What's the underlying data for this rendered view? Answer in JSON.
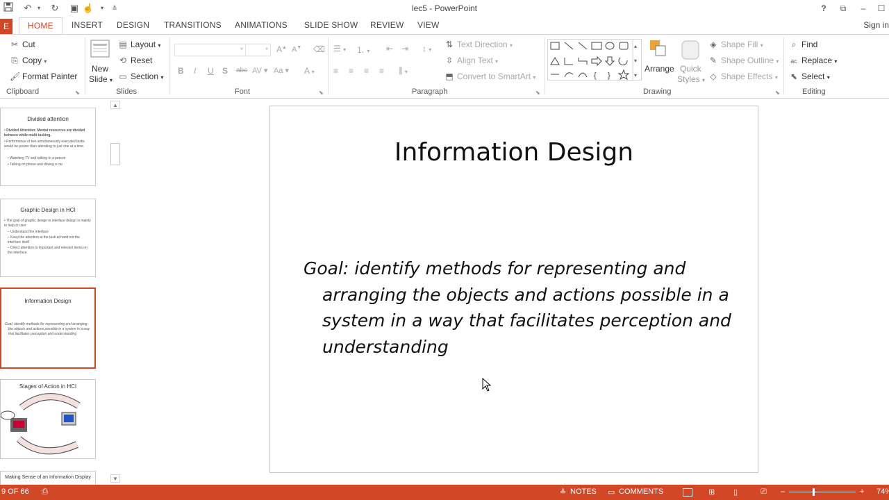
{
  "window": {
    "title": "lec5 - PowerPoint"
  },
  "qat": {
    "save_icon": "save-icon",
    "undo_icon": "undo-icon",
    "redo_icon": "redo-icon"
  },
  "tabs": {
    "file": "E",
    "home": "HOME",
    "insert": "INSERT",
    "design": "DESIGN",
    "transitions": "TRANSITIONS",
    "animations": "ANIMATIONS",
    "slideshow": "SLIDE SHOW",
    "review": "REVIEW",
    "view": "VIEW",
    "signin": "Sign in"
  },
  "ribbon": {
    "clipboard": {
      "cut": "Cut",
      "copy": "Copy",
      "format_painter": "Format Painter",
      "label": "Clipboard"
    },
    "slides": {
      "new_slide": "New",
      "new_slide2": "Slide",
      "layout": "Layout",
      "reset": "Reset",
      "section": "Section",
      "label": "Slides"
    },
    "font": {
      "label": "Font"
    },
    "paragraph": {
      "text_direction": "Text Direction",
      "align_text": "Align Text",
      "convert_smartart": "Convert to SmartArt",
      "label": "Paragraph"
    },
    "drawing": {
      "arrange": "Arrange",
      "quick_styles": "Quick",
      "quick_styles2": "Styles",
      "shape_fill": "Shape Fill",
      "shape_outline": "Shape Outline",
      "shape_effects": "Shape Effects",
      "label": "Drawing"
    },
    "editing": {
      "find": "Find",
      "replace": "Replace",
      "select": "Select",
      "label": "Editing"
    }
  },
  "thumbnails": [
    {
      "title": "Divided attention",
      "lines": [
        "Divided Attention: Mental resources are divided between while multi-tasking.",
        "Performance of two simultaneously executed tasks would be poorer than attending to just one at a time.",
        "Watching TV and talking to a person",
        "Talking on phone and driving a car"
      ]
    },
    {
      "title": "Graphic Design in HCI",
      "lines": [
        "The goal of graphic design in interface design is mainly to help to user",
        "– Understand the interface",
        "– Keep the attention at the task at hand not the interface itself",
        "– Direct attention to important and relevant items on the interface"
      ]
    },
    {
      "title": "Information Design",
      "lines": [
        "Goal: identify methods for representing and arranging the objects and actions possible in a system in a way that facilitates perception and understanding"
      ]
    },
    {
      "title": "Stages of Action in HCI",
      "lines": []
    },
    {
      "title": "Making Sense of an Information Display",
      "lines": []
    }
  ],
  "slide": {
    "title": "Information Design",
    "body": "Goal: identify methods for representing and arranging the objects and actions possible in a system in a way that facilitates perception and understanding"
  },
  "status": {
    "slide_count": "9 OF 66",
    "notes": "NOTES",
    "comments": "COMMENTS",
    "zoom": "74%"
  },
  "colors": {
    "accent": "#d24726"
  }
}
